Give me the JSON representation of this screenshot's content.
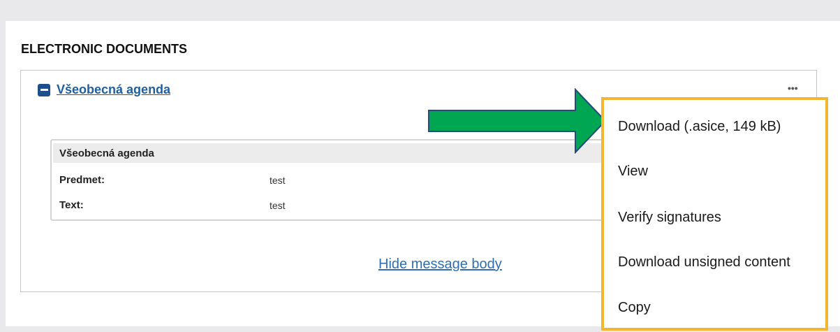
{
  "section": {
    "title": "ELECTRONIC DOCUMENTS"
  },
  "document": {
    "toggle_icon": "minus-square-icon",
    "title": "Všeobecná agenda",
    "more_icon": "ellipsis-icon",
    "form": {
      "header": "Všeobecná agenda",
      "fields": [
        {
          "label": "Predmet:",
          "value": "test"
        },
        {
          "label": "Text:",
          "value": "test"
        }
      ]
    },
    "hide_body_label": "Hide message body"
  },
  "context_menu": {
    "items": [
      {
        "label": "Download (.asice, 149 kB)"
      },
      {
        "label": "View"
      },
      {
        "label": "Verify signatures"
      },
      {
        "label": "Download unsigned content"
      },
      {
        "label": "Copy"
      }
    ]
  },
  "annotation": {
    "arrow_icon": "arrow-right-icon"
  },
  "colors": {
    "highlight_border": "#f2b632",
    "arrow_fill": "#00a651",
    "arrow_stroke": "#1f4e79",
    "link": "#1f5f9e"
  }
}
